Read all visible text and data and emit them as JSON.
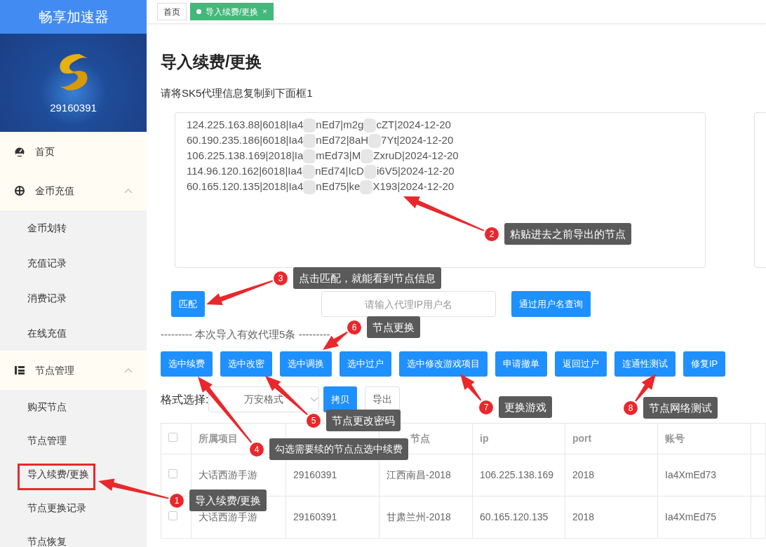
{
  "sidebar": {
    "brand": "畅享加速器",
    "user_id": "29160391",
    "menu": [
      {
        "label": "首页"
      },
      {
        "label": "金币充值",
        "expanded": true,
        "children": [
          {
            "label": "金币划转"
          },
          {
            "label": "充值记录"
          },
          {
            "label": "消费记录"
          },
          {
            "label": "在线充值"
          }
        ]
      },
      {
        "label": "节点管理",
        "expanded": true,
        "children": [
          {
            "label": "购买节点"
          },
          {
            "label": "节点管理"
          },
          {
            "label": "导入续费/更换"
          },
          {
            "label": "节点更换记录"
          },
          {
            "label": "节点恢复"
          }
        ]
      }
    ]
  },
  "tabs": [
    {
      "label": "首页",
      "selected": false
    },
    {
      "label": "导入续费/更换",
      "selected": true,
      "close": "×"
    }
  ],
  "page_title": "导入续费/更换",
  "instruction": "请将SK5代理信息复制到下面框1",
  "import_lines": [
    [
      "124.225.163.88|6018|Ia4",
      "nEd7|m2g",
      "cZT|2024-12-20"
    ],
    [
      "60.190.235.186|6018|Ia4",
      "nEd72|8aH",
      "7Yt|2024-12-20"
    ],
    [
      "106.225.138.169|2018|Ia",
      "mEd73|M",
      "ZxruD|2024-12-20"
    ],
    [
      "114.96.120.162|6018|Ia4",
      "nEd74|IcD",
      "i6V5|2024-12-20"
    ],
    [
      "60.165.120.135|2018|Ia4",
      "nEd75|ke",
      "X193|2024-12-20"
    ]
  ],
  "match_button": "匹配",
  "search": {
    "placeholder": "请输入代理IP用户名"
  },
  "query_button": "通过用户名查询",
  "result_note": "--------- 本次导入有效代理5条 ---------",
  "actions": [
    "选中续费",
    "选中改密",
    "选中调换",
    "选中过户",
    "选中修改游戏项目",
    "申请撤单",
    "返回过户",
    "连通性测试",
    "修复IP"
  ],
  "format": {
    "label": "格式选择:",
    "value": "万安格式",
    "copy": "拷贝",
    "export": "导出"
  },
  "table": {
    "all_checked": false,
    "columns": [
      {
        "label": "所属项目"
      },
      {},
      {
        "label": "节点"
      },
      {
        "label": "ip"
      },
      {
        "label": "port"
      },
      {
        "label": "账号"
      }
    ],
    "rows": [
      {
        "checked": false,
        "cells": [
          "大话西游手游",
          "29160391",
          "江西南昌-2018",
          "106.225.138.169",
          "2018",
          "Ia4XmEd73"
        ]
      },
      {
        "checked": false,
        "cells": [
          "大话西游手游",
          "29160391",
          "甘肃兰州-2018",
          "60.165.120.135",
          "2018",
          "Ia4XmEd75"
        ]
      }
    ]
  },
  "annotations": [
    {
      "number": "2",
      "text": "粘贴进去之前导出的节点"
    },
    {
      "number": "3",
      "text": "点击匹配，就能看到节点信息"
    },
    {
      "number": "6",
      "text": "节点更换"
    },
    {
      "number": "7",
      "text": "更换游戏"
    },
    {
      "number": "8",
      "text": "节点网络测试"
    },
    {
      "number": "5",
      "text": "节点更改密码"
    },
    {
      "number": "4",
      "text": "勾选需要续的节点点选中续费"
    },
    {
      "number": "1",
      "text": "导入续费/更换"
    }
  ]
}
